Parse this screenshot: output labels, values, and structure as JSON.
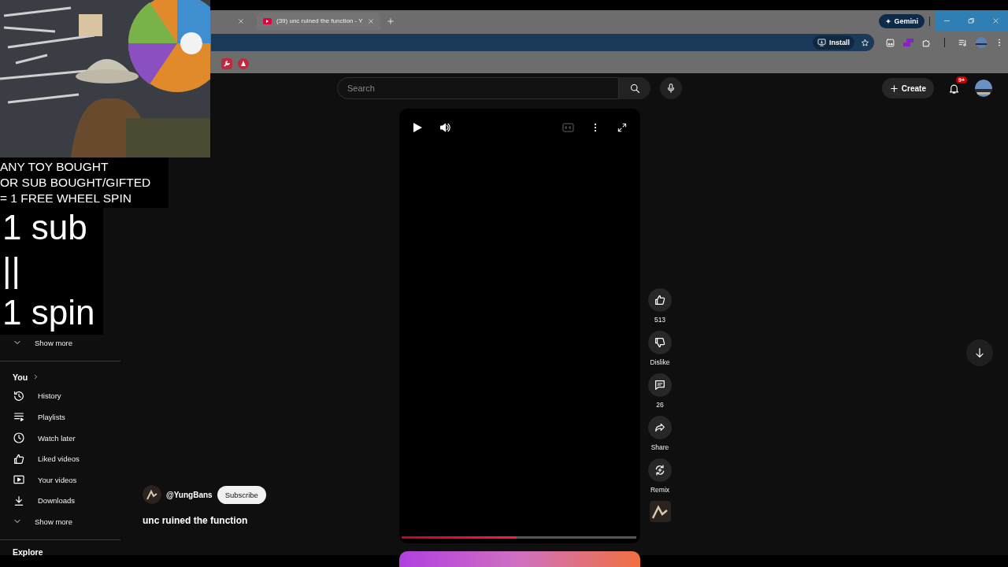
{
  "overlay": {
    "caption_lines": [
      "ANY TOY BOUGHT",
      "OR SUB BOUGHT/GIFTED",
      "= 1 FREE WHEEL SPIN"
    ],
    "big_lines": [
      "1 sub",
      "||",
      "1 spin"
    ]
  },
  "browser": {
    "tabs": [
      {
        "kind": "cut"
      },
      {
        "kind": "full",
        "title": "(39) unc ruined the function - Y"
      }
    ],
    "gemini_button": "Gemini",
    "install_button": "Install"
  },
  "youtube": {
    "search": {
      "placeholder": "Search"
    },
    "create_button": "Create",
    "notification_badge": "9+",
    "sidebar": {
      "show_more_top": "Show more",
      "you_heading": "You",
      "items": [
        {
          "kind": "history",
          "label": "History"
        },
        {
          "kind": "playlists",
          "label": "Playlists"
        },
        {
          "kind": "watch_later",
          "label": "Watch later"
        },
        {
          "kind": "liked",
          "label": "Liked videos"
        },
        {
          "kind": "your_videos",
          "label": "Your videos"
        },
        {
          "kind": "downloads",
          "label": "Downloads"
        }
      ],
      "show_more": "Show more",
      "explore_heading": "Explore"
    },
    "short": {
      "channel": "@YungBans",
      "subscribe_button": "Subscribe",
      "title": "unc ruined the function",
      "progress": {
        "level": 0.49
      },
      "actions": [
        {
          "kind": "like",
          "label": "513"
        },
        {
          "kind": "dislike",
          "label": "Dislike"
        },
        {
          "kind": "comments",
          "label": "26"
        },
        {
          "kind": "share",
          "label": "Share"
        },
        {
          "kind": "remix",
          "label": "Remix"
        }
      ]
    }
  }
}
